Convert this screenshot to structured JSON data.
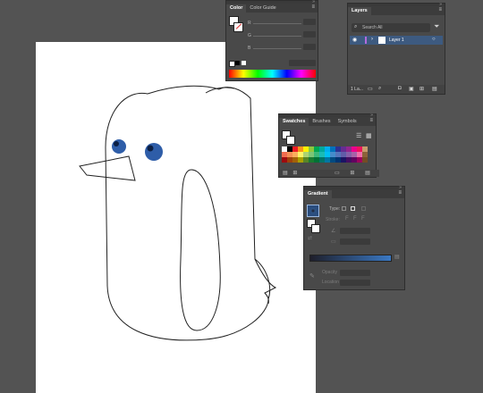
{
  "color_panel": {
    "tabs": [
      "Color",
      "Color Guide"
    ],
    "channel_labels": [
      "R",
      "G",
      "B"
    ],
    "accent": "#e6e6e6"
  },
  "layers_panel": {
    "title": "Layers",
    "search_placeholder": "Search All",
    "layer_name": "Layer 1",
    "footer_label": "1 La..."
  },
  "swatches_panel": {
    "tabs": [
      "Swatches",
      "Brushes",
      "Symbols"
    ]
  },
  "gradient_panel": {
    "title": "Gradient",
    "type_label": "Type:",
    "stroke_label": "Stroke:",
    "opacity_label": "Opacity",
    "location_label": "Location",
    "gradient_colors": [
      "#1e1e2a",
      "#3a79c4"
    ]
  },
  "icons": [
    "menu-icon",
    "filter-icon",
    "eye-icon",
    "chevron-right-icon",
    "new-layer-icon",
    "trash-icon",
    "swatch-grid-icon",
    "swatch-list-icon"
  ]
}
